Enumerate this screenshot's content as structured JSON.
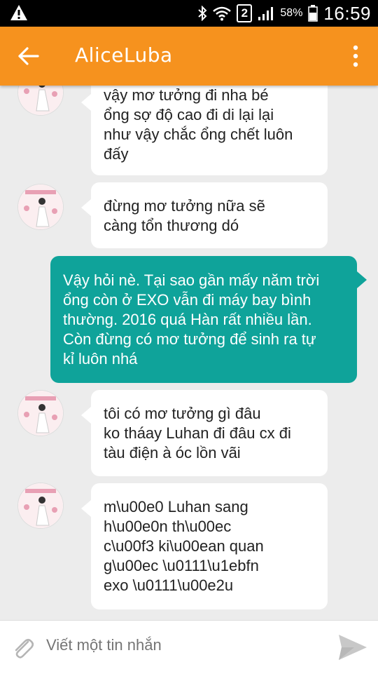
{
  "status_bar": {
    "sim_slot": "2",
    "battery": "58%",
    "time": "16:59"
  },
  "header": {
    "title": "AliceLuba",
    "back_icon": "arrow-left-icon",
    "menu_icon": "more-vert-icon"
  },
  "messages": [
    {
      "direction": "incoming",
      "lines": [
        "vậy mơ tưởng đi nha bé",
        "ổng sợ độ cao đi di lại lại",
        "như vậy chắc ổng chết luôn",
        "đấy"
      ]
    },
    {
      "direction": "incoming",
      "lines": [
        "đừng mơ tưởng nữa sẽ",
        "càng tổn thương dó"
      ]
    },
    {
      "direction": "outgoing",
      "lines": [
        "Vậy hỏi nè. Tại sao gần mấy năm trời",
        "ổng còn ở EXO vẫn đi máy bay bình",
        "thường. 2016 quá Hàn rất nhiều lần.",
        "Còn đừng có mơ tưởng để sinh ra tự",
        "kỉ luôn nhá"
      ]
    },
    {
      "direction": "incoming",
      "lines": [
        "tôi có mơ tưởng gì đâu",
        "ko tháay Luhan đi đâu cx đi",
        "tàu điện à óc lồn vãi"
      ]
    },
    {
      "direction": "incoming",
      "lines": [
        "m\\u00e0 Luhan sang",
        "h\\u00e0n th\\u00ec",
        "c\\u00f3 ki\\u00ean quan",
        "g\\u00ec \\u0111\\u1ebfn",
        "exo \\u0111\\u00e2u"
      ]
    }
  ],
  "composer": {
    "placeholder": "Viết một tin nhắn",
    "attach_icon": "paperclip-icon",
    "send_icon": "send-icon"
  },
  "colors": {
    "app_bar": "#f6921e",
    "outgoing_bubble": "#0fa39a",
    "incoming_bubble": "#ffffff",
    "background": "#ececec"
  }
}
